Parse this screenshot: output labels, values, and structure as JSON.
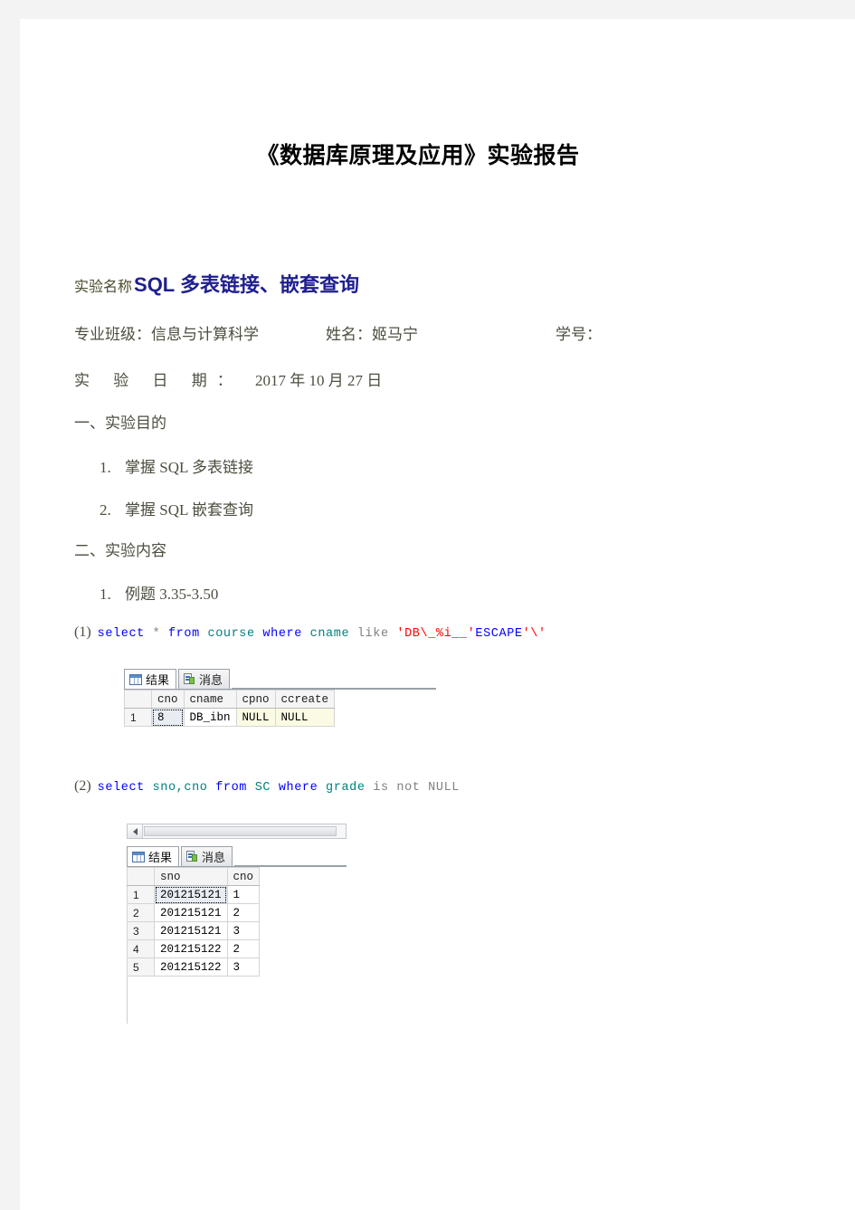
{
  "document": {
    "title": "《数据库原理及应用》实验报告",
    "experiment_name_label": "实验名称",
    "experiment_name_value": "SQL 多表链接、嵌套查询",
    "class_label": "专业班级：信息与计算科学",
    "student_name_label": "姓名：姬马宁",
    "student_id_label": "学号：",
    "date_label": "实 验 日 期：",
    "date_value": "2017 年 10 月 27 日",
    "sections": [
      {
        "heading": "一、实验目的",
        "items": [
          {
            "num": "1.",
            "text": "掌握 SQL 多表链接"
          },
          {
            "num": "2.",
            "text": "掌握 SQL 嵌套查询"
          }
        ]
      },
      {
        "heading": "二、实验内容",
        "items": [
          {
            "num": "1.",
            "text": "例题 3.35-3.50"
          }
        ]
      }
    ]
  },
  "queries": [
    {
      "index": "(1)",
      "tokens": [
        {
          "t": "select",
          "c": "kw"
        },
        {
          "t": " * ",
          "c": "op"
        },
        {
          "t": "from",
          "c": "kw"
        },
        {
          "t": " ",
          "c": "op"
        },
        {
          "t": "course",
          "c": "iden"
        },
        {
          "t": " ",
          "c": "op"
        },
        {
          "t": "where",
          "c": "kw"
        },
        {
          "t": " ",
          "c": "op"
        },
        {
          "t": "cname",
          "c": "iden"
        },
        {
          "t": " like ",
          "c": "plain"
        },
        {
          "t": "'DB\\_%i__'",
          "c": "str"
        },
        {
          "t": "ESCAPE",
          "c": "kw"
        },
        {
          "t": "'\\'",
          "c": "str"
        }
      ],
      "result": {
        "tabs": [
          {
            "label": "结果",
            "icon": "grid-icon",
            "active": true
          },
          {
            "label": "消息",
            "icon": "message-icon",
            "active": false
          }
        ],
        "columns": [
          "cno",
          "cname",
          "cpno",
          "ccreate"
        ],
        "rows": [
          {
            "n": "1",
            "cells": [
              {
                "v": "8",
                "style": "selected"
              },
              {
                "v": "DB_ibn",
                "style": "normal"
              },
              {
                "v": "NULL",
                "style": "null"
              },
              {
                "v": "NULL",
                "style": "null"
              }
            ]
          }
        ],
        "has_scrollbar": false
      }
    },
    {
      "index": "(2)",
      "tokens": [
        {
          "t": "select",
          "c": "kw"
        },
        {
          "t": " ",
          "c": "op"
        },
        {
          "t": "sno,cno",
          "c": "iden"
        },
        {
          "t": " ",
          "c": "op"
        },
        {
          "t": "from",
          "c": "kw"
        },
        {
          "t": " ",
          "c": "op"
        },
        {
          "t": "SC",
          "c": "iden"
        },
        {
          "t": " ",
          "c": "op"
        },
        {
          "t": "where",
          "c": "kw"
        },
        {
          "t": " ",
          "c": "op"
        },
        {
          "t": "grade",
          "c": "iden"
        },
        {
          "t": " is not NULL",
          "c": "plain"
        }
      ],
      "result": {
        "tabs": [
          {
            "label": "结果",
            "icon": "grid-icon",
            "active": true
          },
          {
            "label": "消息",
            "icon": "message-icon",
            "active": false
          }
        ],
        "columns": [
          "sno",
          "cno"
        ],
        "rows": [
          {
            "n": "1",
            "cells": [
              {
                "v": "201215121",
                "style": "selected"
              },
              {
                "v": "1",
                "style": "normal"
              }
            ]
          },
          {
            "n": "2",
            "cells": [
              {
                "v": "201215121",
                "style": "normal"
              },
              {
                "v": "2",
                "style": "normal"
              }
            ]
          },
          {
            "n": "3",
            "cells": [
              {
                "v": "201215121",
                "style": "normal"
              },
              {
                "v": "3",
                "style": "normal"
              }
            ]
          },
          {
            "n": "4",
            "cells": [
              {
                "v": "201215122",
                "style": "normal"
              },
              {
                "v": "2",
                "style": "normal"
              }
            ]
          },
          {
            "n": "5",
            "cells": [
              {
                "v": "201215122",
                "style": "normal"
              },
              {
                "v": "3",
                "style": "normal"
              }
            ]
          }
        ],
        "has_scrollbar": true
      }
    }
  ],
  "colors": {
    "keyword": "#0000ff",
    "identifier": "#008080",
    "string": "#ff0000",
    "plain": "#808080",
    "heading_text": "#4d4d3f",
    "exp_value": "#1f1f8f",
    "null_cell_bg": "#fbfbe3",
    "selected_cell_bg": "#e7edf3"
  }
}
